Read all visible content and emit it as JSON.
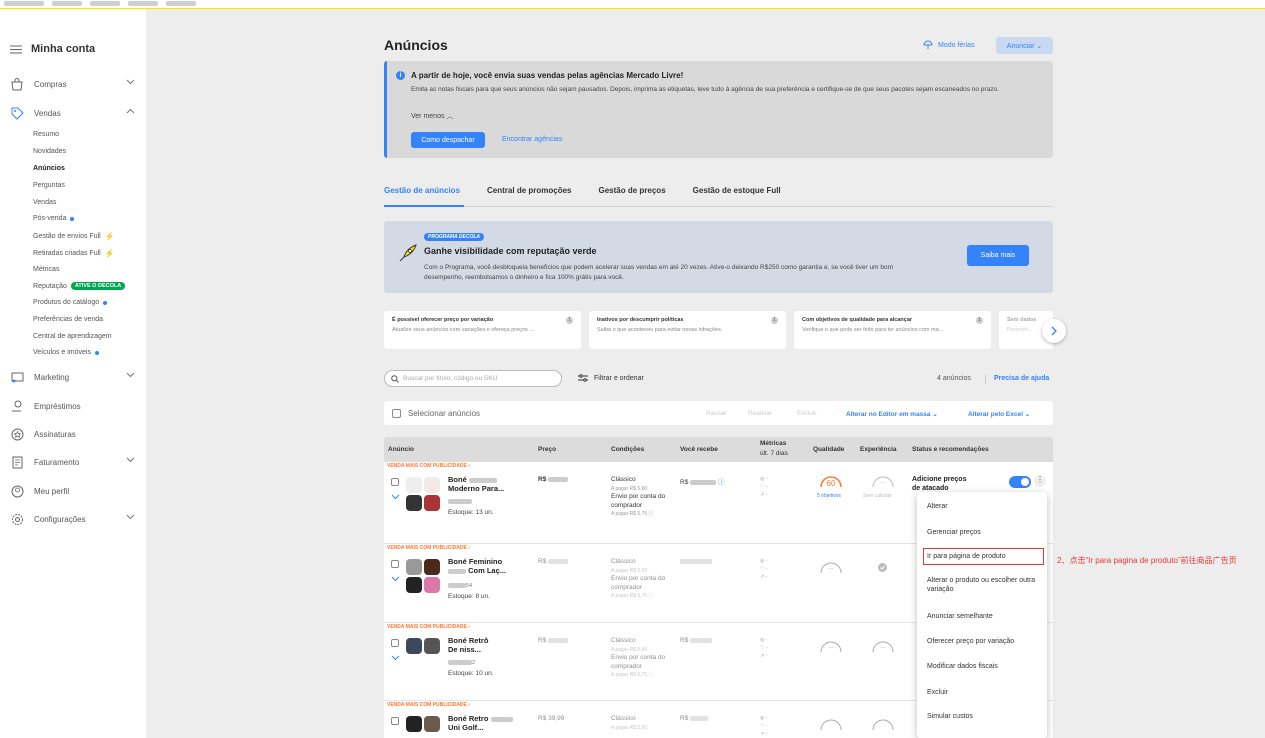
{
  "sidebar": {
    "title": "Minha conta",
    "sections": {
      "compras": "Compras",
      "vendas": "Vendas",
      "marketing": "Marketing",
      "emprestimos": "Empréstimos",
      "assinaturas": "Assinaturas",
      "faturamento": "Faturamento",
      "perfil": "Meu perfil",
      "config": "Configurações"
    },
    "vendas_items": {
      "resumo": "Resumo",
      "novidades": "Novidades",
      "anuncios": "Anúncios",
      "perguntas": "Perguntas",
      "vendas": "Vendas",
      "posvenda": "Pós-venda",
      "envios": "Gestão de envios Full",
      "retiradas": "Retiradas criadas Full",
      "metricas": "Métricas",
      "reputacao": "Reputação",
      "reputacao_badge": "ATIVE O DECOLA",
      "produtos": "Produtos do catálogo",
      "preferencias": "Preferências de venda",
      "aprendizagem": "Central de aprendizagem",
      "veiculos": "Veículos e imóveis"
    }
  },
  "header": {
    "title": "Anúncios",
    "modo_ferias": "Modo férias",
    "anunciar": "Anunciar ⌄"
  },
  "notice": {
    "title": "A partir de hoje, você envia suas vendas pelas agências Mercado Livre!",
    "body": "Emita as notas fiscais para que seus anúncios não sejam pausados. Depois, imprima as etiquetas, leve tudo à agência de sua preferência e certifique-se de que seus pacotes sejam escaneados no prazo.",
    "ver_menos": "Ver menos ︿",
    "button": "Como despachar",
    "link": "Encontrar agências"
  },
  "tabs": {
    "t1": "Gestão de anúncios",
    "t2": "Central de promoções",
    "t3": "Gestão de preços",
    "t4": "Gestão de estoque Full"
  },
  "decola": {
    "tag": "PROGRAMA DECOLA",
    "title": "Ganhe visibilidade com reputação verde",
    "body": "Com o Programa, você desbloqueia benefícios que podem acelerar suas vendas em até 20 vezes. Ative-o deixando R$250 como garantia e, se você tiver um bom desempenho, reembolsamos o dinheiro e fica 100% grátis para você.",
    "button": "Saiba mais"
  },
  "cards": {
    "c1_title": "É possível oferecer preço por variação",
    "c1_desc": "Atualize seus anúncios com variações e ofereça preços ...",
    "c2_title": "Inativos por descumprir políticas",
    "c2_desc": "Saiba o que aconteceu para evitar novas infrações.",
    "c3_title": "Com objetivos de qualidade para alcançar",
    "c3_desc": "Verifique o que pode ser feito para ter anúncios com ma...",
    "c4_title": "Sem dados",
    "c4_desc": "Preench..."
  },
  "toolbar": {
    "search_placeholder": "Buscar por título, código ou SKU",
    "filter": "Filtrar e ordenar",
    "count": "4 anúncios",
    "help": "Precisa de ajuda"
  },
  "selbar": {
    "select": "Selecionar anúncios",
    "pausar": "Pausar",
    "reativar": "Reativar",
    "excluir": "Excluir",
    "editor": "Alterar no Editor em massa ⌄",
    "excel": "Alterar pelo Excel ⌄"
  },
  "table": {
    "h_anuncio": "Anúncio",
    "h_preco": "Preço",
    "h_cond": "Condições",
    "h_recebe": "Você recebe",
    "h_metricas": "Métricas",
    "h_metricas2": "últ. 7 dias",
    "h_qual": "Qualidade",
    "h_exp": "Experiência",
    "h_status": "Status e recomendações",
    "promo": "VENDA MAIS COM PUBLICIDADE ›",
    "r1_t1": "Boné",
    "r1_t2": "Moderno Para...",
    "r1_stock": "Estoque: 13 un.",
    "r1_price": "R$",
    "r1_recebe": "R$",
    "r1_q": "60",
    "r1_qlink": "5 objetivos",
    "r1_exp": "Sem calcular",
    "r1_status": "Adicione preços de atacado",
    "r2_t1": "Boné Feminino",
    "r2_t2": "Com Laç...",
    "r2_sku": "54",
    "r2_stock": "Estoque: 8 un.",
    "r2_price": "R$",
    "r3_t1": "Boné Retrô",
    "r3_t2": "De       niss...",
    "r3_sku": "2",
    "r3_stock": "Estoque: 10 un.",
    "r3_price": "R$",
    "r3_recebe": "R$",
    "r4_t1": "Boné Retro",
    "r4_t2": "Uni      Golf...",
    "r4_price": "R$ 39,99",
    "r4_recebe": "R$",
    "cond_classico": "Clássico",
    "cond_pagar1": "A pagar R$ 5,60",
    "cond_envio": "Envio por conta do comprador",
    "cond_pagar2": "A pagar R$ 6,75 ⓘ",
    "met_lines": "◎ -\n♡ -\n↗ -"
  },
  "menu": {
    "m1": "Alterar",
    "m2": "Gerenciar preços",
    "m3": "Ir para página de produto",
    "m4": "Alterar o produto ou escolher outra variação",
    "m5": "Anunciar semelhante",
    "m6": "Oferecer preço por variação",
    "m7": "Modificar dados fiscais",
    "m8": "Excluir",
    "m9": "Simular custos"
  },
  "annotation": "2、点击“Ir para pagina de produto”前往商品广告页",
  "colors": {
    "accent": "#3483fa",
    "annotation": "#e53935",
    "promo": "#ff7733",
    "green": "#00a650"
  }
}
